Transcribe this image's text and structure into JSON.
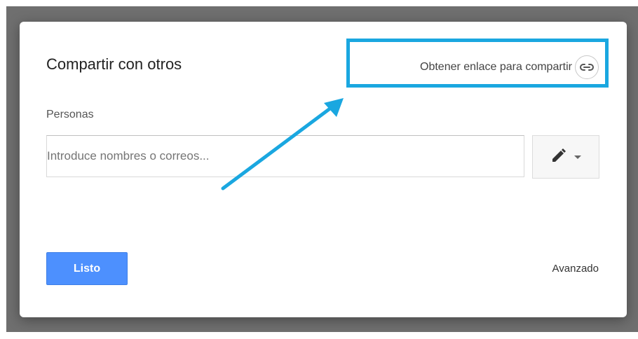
{
  "dialog": {
    "title": "Compartir con otros",
    "get_link_label": "Obtener enlace para compartir",
    "link_icon": "link-icon",
    "people_label": "Personas",
    "input_placeholder": "Introduce nombres o correos...",
    "permission_icons": [
      "pencil-icon",
      "caret-down-icon"
    ],
    "done_label": "Listo",
    "advanced_label": "Avanzado"
  },
  "annotation": {
    "highlight_color": "#1aa7e0",
    "arrow_color": "#1aa7e0"
  },
  "colors": {
    "primary_button": "#4d90fe",
    "backdrop": "#6f6f6f"
  }
}
